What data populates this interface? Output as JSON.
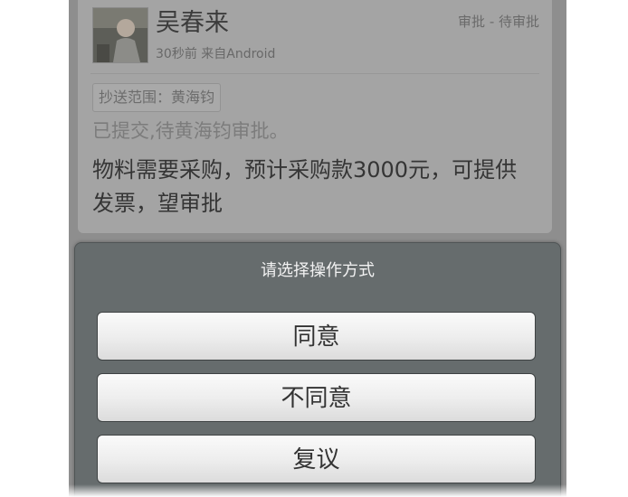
{
  "post": {
    "author": "吴春来",
    "meta": "30秒前  来自Android",
    "status": "审批 - 待审批",
    "cc": "抄送范围：黄海钧",
    "submitted": "已提交,待黄海钧审批。",
    "content": "物料需要采购，预计采购款3000元，可提供发票，望审批"
  },
  "dialog": {
    "title": "请选择操作方式",
    "options": [
      "同意",
      "不同意",
      "复议"
    ]
  },
  "icons": {
    "avatar": "user-photo"
  }
}
